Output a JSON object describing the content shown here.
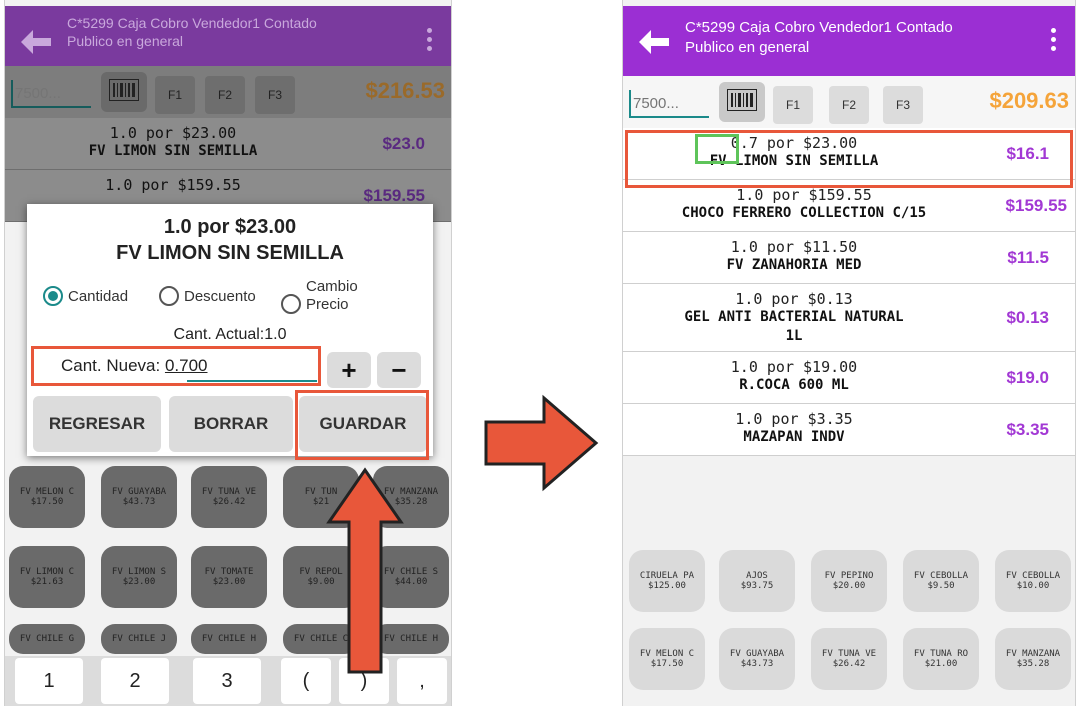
{
  "header": {
    "title_line1": "C*5299 Caja Cobro Vendedor1 Contado",
    "title_line2": "Publico en general"
  },
  "toolbar": {
    "code_placeholder": "7500...",
    "fkeys": [
      "F1",
      "F2",
      "F3"
    ]
  },
  "left": {
    "total": "$216.53",
    "items": [
      {
        "qty": "1.0 por $23.00",
        "name": "FV LIMON SIN SEMILLA",
        "price": "$23.0"
      },
      {
        "qty": "1.0 por $159.55",
        "name": "",
        "price": "$159.55"
      }
    ],
    "dialog": {
      "qty_line": "1.0 por $23.00",
      "name_line": "FV LIMON SIN SEMILLA",
      "radio_cantidad": "Cantidad",
      "radio_descuento": "Descuento",
      "radio_cambio_1": "Cambio",
      "radio_cambio_2": "Precio",
      "current": "Cant. Actual:1.0",
      "new_label": "Cant. Nueva: ",
      "new_value": "0.700",
      "plus": "+",
      "minus": "−",
      "btn_regresar": "REGRESAR",
      "btn_borrar": "BORRAR",
      "btn_guardar": "GUARDAR"
    },
    "grid": [
      {
        "name": "FV MELON C",
        "price": "$17.50"
      },
      {
        "name": "FV GUAYABA",
        "price": "$43.73"
      },
      {
        "name": "FV TUNA VE",
        "price": "$26.42"
      },
      {
        "name": "FV TUN",
        "price": "$21"
      },
      {
        "name": "FV MANZANA",
        "price": "$35.28"
      },
      {
        "name": "FV LIMON C",
        "price": "$21.63"
      },
      {
        "name": "FV LIMON S",
        "price": "$23.00"
      },
      {
        "name": "FV TOMATE",
        "price": "$23.00"
      },
      {
        "name": "FV REPOL",
        "price": "$9.00"
      },
      {
        "name": "FV CHILE S",
        "price": "$44.00"
      },
      {
        "name": "FV CHILE G",
        "price": ""
      },
      {
        "name": "FV CHILE J",
        "price": ""
      },
      {
        "name": "FV CHILE H",
        "price": ""
      },
      {
        "name": "FV CHILE C",
        "price": ""
      },
      {
        "name": "FV CHILE H",
        "price": ""
      }
    ],
    "keys": [
      "1",
      "2",
      "3",
      "(",
      ")",
      ","
    ]
  },
  "right": {
    "total": "$209.63",
    "items": [
      {
        "qty_num": "0.7",
        "qty_rest": " por $23.00",
        "name": "FV LIMON SIN SEMILLA",
        "price": "$16.1"
      },
      {
        "qty": "1.0 por $159.55",
        "name": "CHOCO FERRERO COLLECTION C/15",
        "price": "$159.55"
      },
      {
        "qty": "1.0 por $11.50",
        "name": "FV ZANAHORIA MED",
        "price": "$11.5"
      },
      {
        "qty": "1.0 por $0.13",
        "name": "GEL ANTI BACTERIAL NATURAL",
        "name2": "1L",
        "price": "$0.13"
      },
      {
        "qty": "1.0 por $19.00",
        "name": "R.COCA 600 ML",
        "price": "$19.0"
      },
      {
        "qty": "1.0 por $3.35",
        "name": "MAZAPAN INDV",
        "price": "$3.35"
      }
    ],
    "grid": [
      {
        "name": "CIRUELA PA",
        "price": "$125.00"
      },
      {
        "name": "AJOS",
        "price": "$93.75"
      },
      {
        "name": "FV PEPINO",
        "price": "$20.00"
      },
      {
        "name": "FV CEBOLLA",
        "price": "$9.50"
      },
      {
        "name": "FV CEBOLLA",
        "price": "$10.00"
      },
      {
        "name": "FV MELON C",
        "price": "$17.50"
      },
      {
        "name": "FV GUAYABA",
        "price": "$43.73"
      },
      {
        "name": "FV TUNA VE",
        "price": "$26.42"
      },
      {
        "name": "FV TUNA RO",
        "price": "$21.00"
      },
      {
        "name": "FV MANZANA",
        "price": "$35.28"
      }
    ]
  },
  "colors": {
    "header": "#9b2fd3",
    "price": "#a238d4",
    "total": "#f5a43a",
    "highlight": "#e8573a",
    "highlight_green": "#5ec45a"
  }
}
